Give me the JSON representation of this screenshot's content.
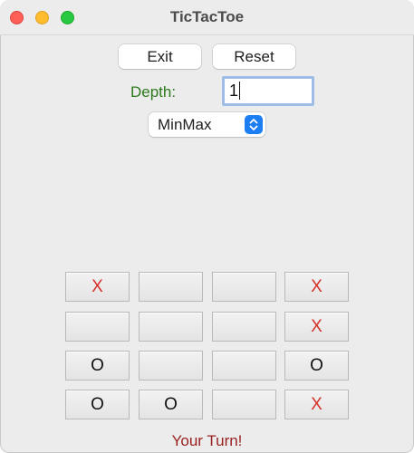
{
  "window": {
    "title": "TicTacToe"
  },
  "toolbar": {
    "exit_label": "Exit",
    "reset_label": "Reset"
  },
  "depth": {
    "label": "Depth:",
    "value": "1"
  },
  "algorithm": {
    "selected": "MinMax"
  },
  "board": {
    "rows": [
      [
        "X",
        "",
        "",
        "X"
      ],
      [
        "",
        "",
        "",
        "X"
      ],
      [
        "O",
        "",
        "",
        "O"
      ],
      [
        "O",
        "O",
        "",
        "X"
      ]
    ]
  },
  "status": {
    "text": "Your Turn!"
  },
  "colors": {
    "x_mark": "#d6302a",
    "o_mark": "#111111",
    "depth_label": "#2d7a1d",
    "status_text": "#9a1f1f",
    "select_accent": "#1d7df3",
    "input_focus_ring": "#9dbde6"
  },
  "icons": {
    "close": "traffic-close-icon",
    "minimize": "traffic-minimize-icon",
    "maximize": "traffic-maximize-icon",
    "select_arrows": "chevron-updown-icon"
  }
}
